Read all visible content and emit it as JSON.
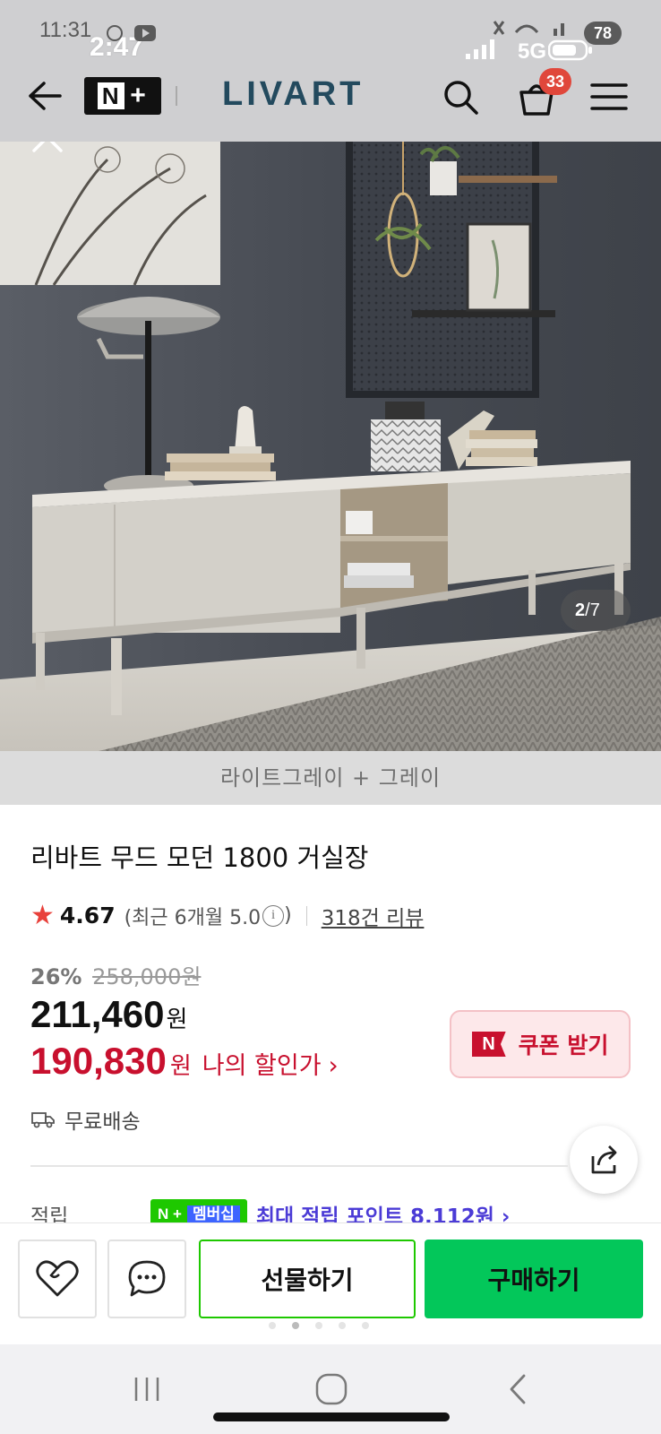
{
  "status_bar": {
    "time_background": "11:31",
    "time": "2:47",
    "network": "5G",
    "battery": "78"
  },
  "header": {
    "membership_badge": "N+",
    "logo": "LIVART",
    "cart_count": "33",
    "icons": [
      "back-arrow-icon",
      "search-icon",
      "cart-icon",
      "menu-icon"
    ]
  },
  "gallery": {
    "current": "2",
    "separator": "/",
    "total": "7",
    "option_caption": "라이트그레이 + 그레이"
  },
  "product": {
    "title": "리바트 무드 모던 1800 거실장",
    "rating": "4.67",
    "rating_recent": "(최근 6개월 5.0",
    "rating_recent_close": ")",
    "review_link": "318건 리뷰",
    "discount_percent": "26%",
    "original_price": "258,000원",
    "sale_price": "211,460",
    "currency": "원",
    "my_price": "190,830",
    "my_price_currency": "원",
    "my_price_label": "나의 할인가",
    "coupon_badge": "N",
    "coupon_label": "쿠폰 받기",
    "shipping": "무료배송",
    "points_label": "적립",
    "points_badge_main": "N +",
    "points_badge_sub": "멤버십",
    "points_text": "최대 적립 포인트 8,112원 ›"
  },
  "actions": {
    "gift_label": "선물하기",
    "buy_label": "구매하기"
  },
  "colors": {
    "accent_green": "#03c75a",
    "price_red": "#c8102e",
    "logo_blue": "#234a5e",
    "points_purple": "#4b3bd6"
  }
}
